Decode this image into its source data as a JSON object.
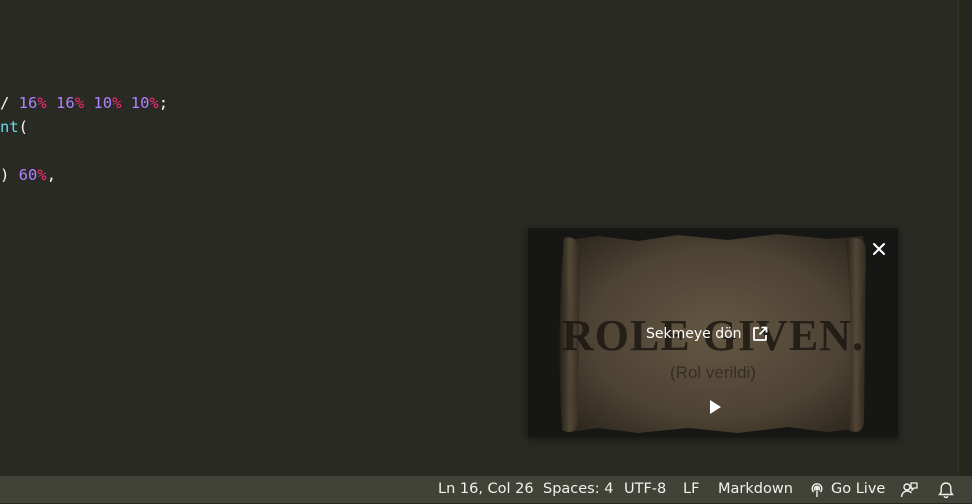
{
  "editor": {
    "lines": [
      {
        "text_slash": "/ ",
        "n1": "16",
        "u1": "%",
        "n2": "16",
        "u2": "%",
        "n3": "10",
        "u3": "%",
        "n4": "10",
        "u4": "%",
        "semi": ";"
      },
      {
        "fn": "nt",
        "paren": "("
      },
      {
        "close": ") ",
        "n": "60",
        "u": "%",
        "comma": ","
      }
    ]
  },
  "pip": {
    "back_to_tab_label": "Sekmeye dön",
    "video_title_main": "ROLE GIVEN.",
    "video_subtitle": "(Rol verildi)"
  },
  "statusbar": {
    "cursor_position": "Ln 16, Col 26",
    "indentation": "Spaces: 4",
    "encoding": "UTF-8",
    "eol": "LF",
    "language": "Markdown",
    "go_live": "Go Live"
  },
  "colors": {
    "background": "#272822",
    "statusbar": "#414339",
    "number": "#ae81ff",
    "unit": "#f92672",
    "function": "#66d9ef"
  }
}
